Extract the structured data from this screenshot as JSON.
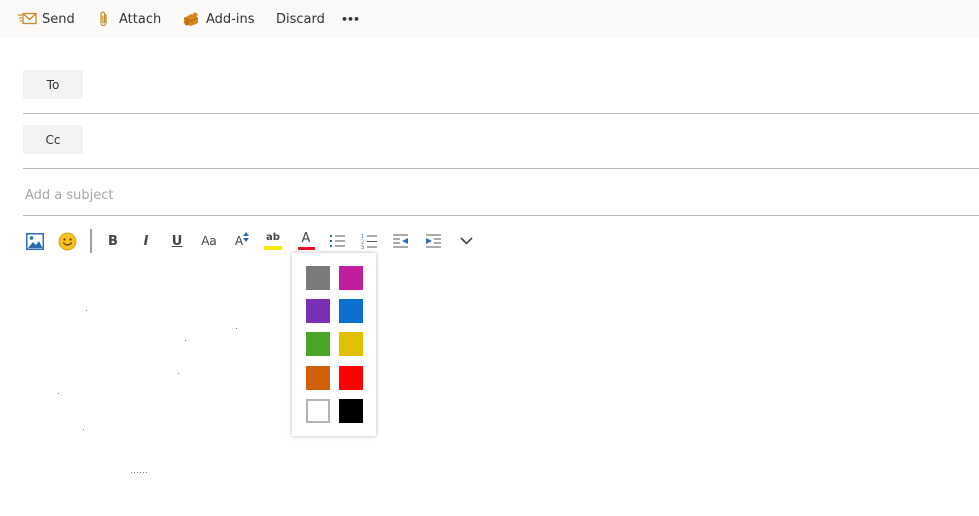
{
  "toolbar": {
    "send_label": "Send",
    "attach_label": "Attach",
    "addins_label": "Add-ins",
    "discard_label": "Discard",
    "more_label": "•••"
  },
  "recipients": {
    "to_label": "To",
    "cc_label": "Cc"
  },
  "subject": {
    "placeholder": "Add a subject"
  },
  "formatting": {
    "bold": "B",
    "italic": "I",
    "underline": "U",
    "font_size": "Aa",
    "grow_font": "A",
    "highlight": "ab",
    "font_color": "A"
  },
  "font_color_palette": {
    "colors": [
      "#7a7a7a",
      "#c01da0",
      "#7a2fb5",
      "#0b6fce",
      "#4aa528",
      "#e0c000",
      "#d0600a",
      "#ff0000",
      "#ffffff",
      "#000000"
    ],
    "accent_font_color": "#e81123"
  }
}
